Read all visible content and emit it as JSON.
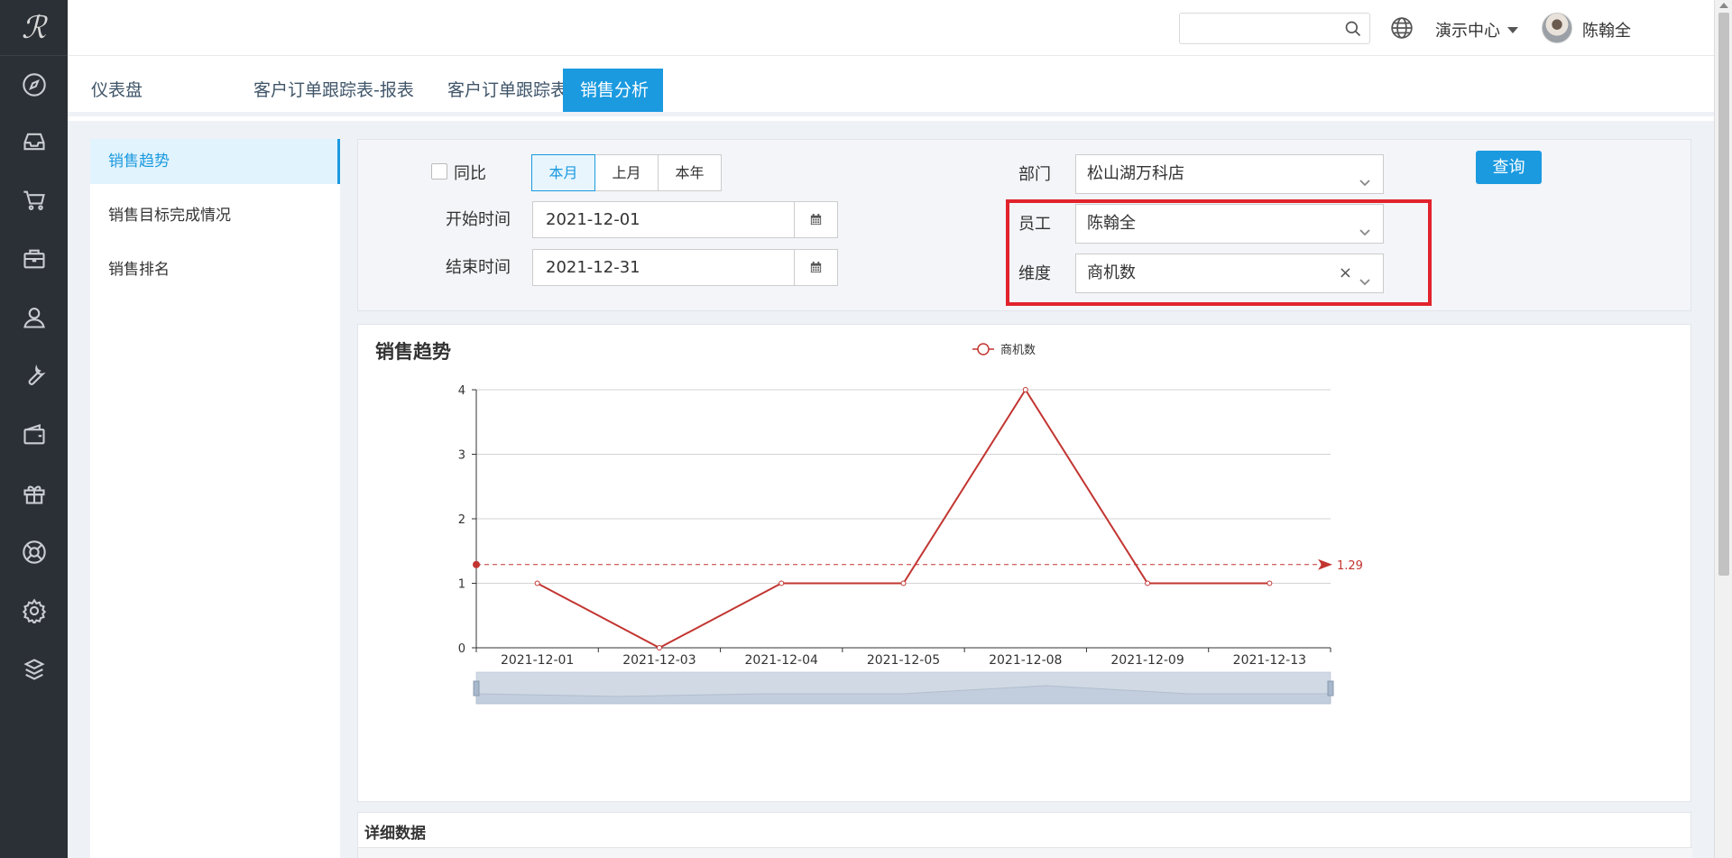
{
  "header": {
    "search_placeholder": "",
    "center_label": "演示中心",
    "user_name": "陈翰全",
    "help_label": "?"
  },
  "tabs": [
    {
      "label": "仪表盘"
    },
    {
      "label": "客户订单跟踪表-报表"
    },
    {
      "label": "客户订单跟踪表-报表"
    },
    {
      "label": "销售分析",
      "close": "✖"
    }
  ],
  "left_nav": [
    "销售趋势",
    "销售目标完成情况",
    "销售排名"
  ],
  "filters": {
    "compare_label": "同比",
    "period_options": [
      "本月",
      "上月",
      "本年"
    ],
    "period_selected": "本月",
    "start_label": "开始时间",
    "start_value": "2021-12-01",
    "end_label": "结束时间",
    "end_value": "2021-12-31",
    "dept_label": "部门",
    "dept_value": "松山湖万科店",
    "staff_label": "员工",
    "staff_value": "陈翰全",
    "dim_label": "维度",
    "dim_value": "商机数",
    "query_label": "查询"
  },
  "chart_title": "销售趋势",
  "detail_title": "详细数据",
  "colors": {
    "accent": "#1b9ae0",
    "series": "#c23531",
    "highlight": "#e1232d",
    "sidebar": "#2b3036"
  },
  "icons": [
    "compass-icon",
    "inbox-icon",
    "cart-icon",
    "briefcase-icon",
    "user-icon",
    "wrench-icon",
    "wallet-icon",
    "gift-icon",
    "lifebuoy-icon",
    "gear-icon",
    "cube-icon"
  ],
  "chart_data": {
    "type": "line",
    "title": "销售趋势",
    "categories": [
      "2021-12-01",
      "2021-12-03",
      "2021-12-04",
      "2021-12-05",
      "2021-12-08",
      "2021-12-09",
      "2021-12-13"
    ],
    "series": [
      {
        "name": "商机数",
        "values": [
          1,
          0,
          1,
          1,
          4,
          1,
          1
        ]
      }
    ],
    "ylim": [
      0,
      4
    ],
    "yticks": [
      0,
      1,
      2,
      3,
      4
    ],
    "average_line": {
      "value": 1.29,
      "label": "1.29"
    },
    "legend_position": "top-center",
    "grid": true,
    "datazoom": true
  }
}
